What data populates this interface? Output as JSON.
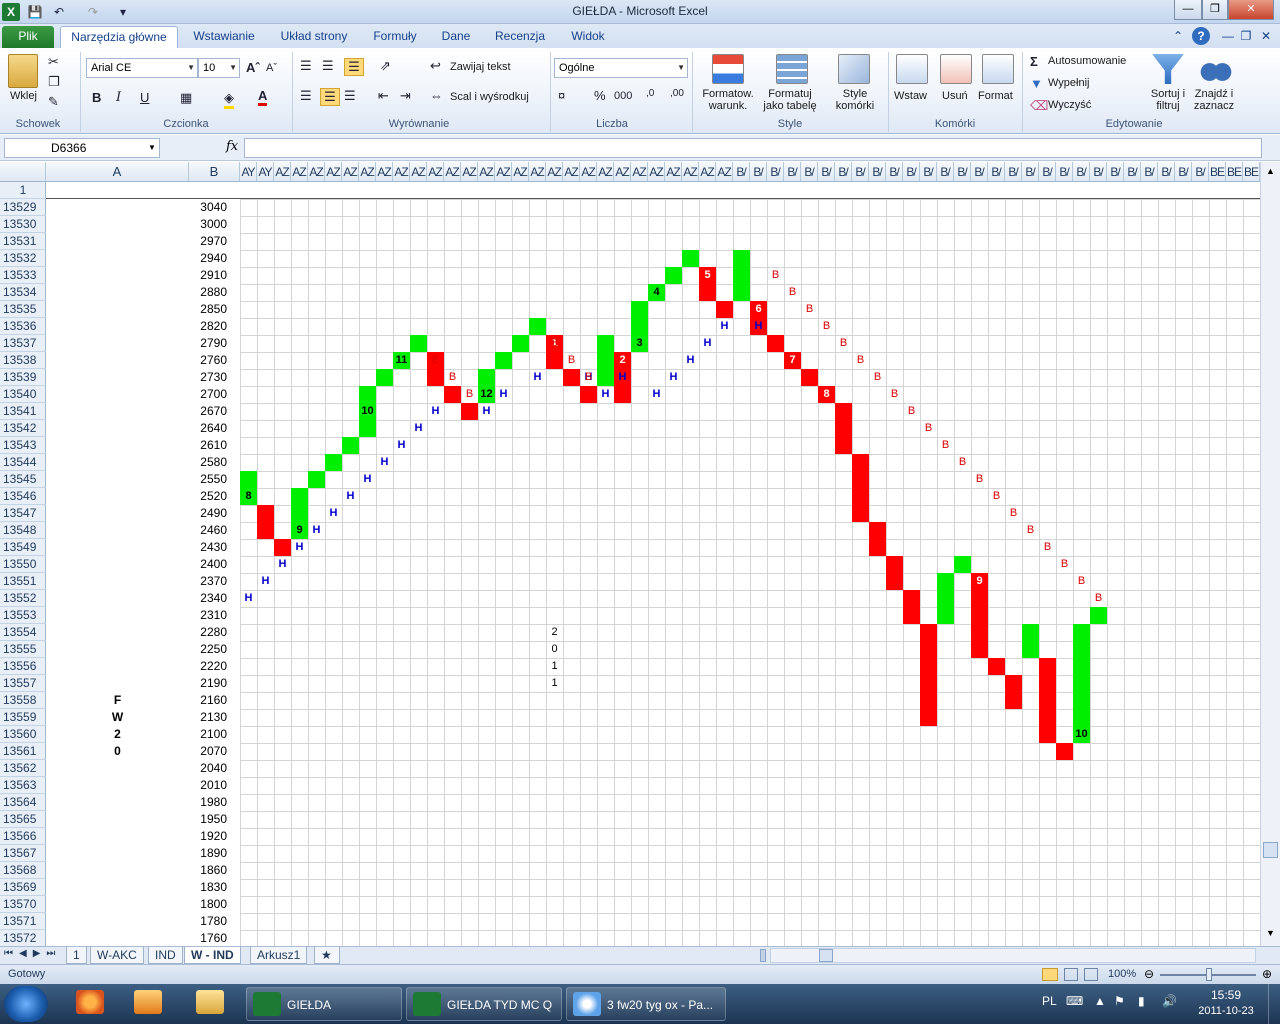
{
  "window": {
    "title": "GIEŁDA  -  Microsoft Excel"
  },
  "ribbon": {
    "tabs": [
      "Plik",
      "Narzędzia główne",
      "Wstawianie",
      "Układ strony",
      "Formuły",
      "Dane",
      "Recenzja",
      "Widok"
    ],
    "groups": {
      "schowek": {
        "label": "Schowek",
        "paste": "Wklej"
      },
      "czcionka": {
        "label": "Czcionka",
        "font": "Arial CE",
        "size": "10",
        "bold": "B",
        "italic": "I",
        "underline": "U"
      },
      "wyrownanie": {
        "label": "Wyrównanie",
        "wrap": "Zawijaj tekst",
        "merge": "Scal i wyśrodkuj"
      },
      "liczba": {
        "label": "Liczba",
        "format": "Ogólne",
        "percent": "%",
        "thousands": "000"
      },
      "style": {
        "label": "Style",
        "cond_line1": "Formatow.",
        "cond_line2": "warunk.",
        "table_line1": "Formatuj",
        "table_line2": "jako tabelę",
        "cell_line1": "Style",
        "cell_line2": "komórki"
      },
      "komorki": {
        "label": "Komórki",
        "insert": "Wstaw",
        "delete": "Usuń",
        "format": "Format"
      },
      "edytowanie": {
        "label": "Edytowanie",
        "autosum": "Autosumowanie",
        "fill": "Wypełnij",
        "clear": "Wyczyść",
        "sort_line1": "Sortuj i",
        "sort_line2": "filtruj",
        "find_line1": "Znajdź i",
        "find_line2": "zaznacz"
      }
    }
  },
  "formula_bar": {
    "name_box": "D6366",
    "fx": "fx",
    "value": ""
  },
  "columns": {
    "A": "A",
    "B": "B",
    "other": [
      "AY",
      "AY",
      "AZ",
      "AZ",
      "AZ",
      "AZ",
      "AZ",
      "AZ",
      "AZ",
      "AZ",
      "AZ",
      "AZ",
      "AZ",
      "AZ",
      "AZ",
      "AZ",
      "AZ",
      "AZ",
      "AZ",
      "AZ",
      "AZ",
      "AZ",
      "AZ",
      "AZ",
      "AZ",
      "AZ",
      "AZ",
      "AZ",
      "AZ",
      "B/",
      "B/",
      "B/",
      "B/",
      "B/",
      "B/",
      "B/",
      "B/",
      "B/",
      "B/",
      "B/",
      "B/",
      "B/",
      "B/",
      "B/",
      "B/",
      "B/",
      "B/",
      "B/",
      "B/",
      "B/",
      "B/",
      "B/",
      "B/",
      "B/",
      "B/",
      "B/",
      "B/",
      "BE",
      "BE",
      "BE",
      "BE",
      "BE",
      "BE",
      "BE",
      "BE",
      "BE",
      "BE"
    ]
  },
  "row_header_first": "1",
  "rows": [
    {
      "n": "13529",
      "a": "",
      "b": "3040"
    },
    {
      "n": "13530",
      "a": "",
      "b": "3000"
    },
    {
      "n": "13531",
      "a": "",
      "b": "2970"
    },
    {
      "n": "13532",
      "a": "",
      "b": "2940"
    },
    {
      "n": "13533",
      "a": "",
      "b": "2910"
    },
    {
      "n": "13534",
      "a": "",
      "b": "2880"
    },
    {
      "n": "13535",
      "a": "",
      "b": "2850"
    },
    {
      "n": "13536",
      "a": "",
      "b": "2820"
    },
    {
      "n": "13537",
      "a": "",
      "b": "2790"
    },
    {
      "n": "13538",
      "a": "",
      "b": "2760"
    },
    {
      "n": "13539",
      "a": "",
      "b": "2730"
    },
    {
      "n": "13540",
      "a": "",
      "b": "2700"
    },
    {
      "n": "13541",
      "a": "",
      "b": "2670"
    },
    {
      "n": "13542",
      "a": "",
      "b": "2640"
    },
    {
      "n": "13543",
      "a": "",
      "b": "2610"
    },
    {
      "n": "13544",
      "a": "",
      "b": "2580"
    },
    {
      "n": "13545",
      "a": "",
      "b": "2550"
    },
    {
      "n": "13546",
      "a": "",
      "b": "2520"
    },
    {
      "n": "13547",
      "a": "",
      "b": "2490"
    },
    {
      "n": "13548",
      "a": "",
      "b": "2460"
    },
    {
      "n": "13549",
      "a": "",
      "b": "2430"
    },
    {
      "n": "13550",
      "a": "",
      "b": "2400"
    },
    {
      "n": "13551",
      "a": "",
      "b": "2370"
    },
    {
      "n": "13552",
      "a": "",
      "b": "2340"
    },
    {
      "n": "13553",
      "a": "",
      "b": "2310"
    },
    {
      "n": "13554",
      "a": "",
      "b": "2280"
    },
    {
      "n": "13555",
      "a": "",
      "b": "2250"
    },
    {
      "n": "13556",
      "a": "",
      "b": "2220"
    },
    {
      "n": "13557",
      "a": "",
      "b": "2190"
    },
    {
      "n": "13558",
      "a": "F",
      "b": "2160"
    },
    {
      "n": "13559",
      "a": "W",
      "b": "2130"
    },
    {
      "n": "13560",
      "a": "2",
      "b": "2100"
    },
    {
      "n": "13561",
      "a": "0",
      "b": "2070"
    },
    {
      "n": "13562",
      "a": "",
      "b": "2040"
    },
    {
      "n": "13563",
      "a": "",
      "b": "2010"
    },
    {
      "n": "13564",
      "a": "",
      "b": "1980"
    },
    {
      "n": "13565",
      "a": "",
      "b": "1950"
    },
    {
      "n": "13566",
      "a": "",
      "b": "1920"
    },
    {
      "n": "13567",
      "a": "",
      "b": "1890"
    },
    {
      "n": "13568",
      "a": "",
      "b": "1860"
    },
    {
      "n": "13569",
      "a": "",
      "b": "1830"
    },
    {
      "n": "13570",
      "a": "",
      "b": "1800"
    },
    {
      "n": "13571",
      "a": "",
      "b": "1780"
    },
    {
      "n": "13572",
      "a": "",
      "b": "1760"
    }
  ],
  "pf_legend": {
    "x_color": "#00ee00",
    "o_color": "#ff0000",
    "h_color": "#0000cc",
    "b_color": "#dd0000"
  },
  "pf_cells": [
    [
      "x",
      0,
      16,
      ""
    ],
    [
      "x",
      0,
      17,
      "8"
    ],
    [
      "o",
      1,
      18,
      ""
    ],
    [
      "o",
      1,
      19,
      ""
    ],
    [
      "o",
      2,
      20,
      ""
    ],
    [
      "x",
      3,
      17,
      ""
    ],
    [
      "x",
      3,
      18,
      ""
    ],
    [
      "x",
      3,
      19,
      "9"
    ],
    [
      "x",
      4,
      16,
      ""
    ],
    [
      "x",
      5,
      15,
      ""
    ],
    [
      "x",
      6,
      14,
      ""
    ],
    [
      "x",
      7,
      13,
      ""
    ],
    [
      "x",
      7,
      12,
      "10"
    ],
    [
      "x",
      7,
      11,
      ""
    ],
    [
      "x",
      8,
      10,
      ""
    ],
    [
      "x",
      9,
      9,
      "11"
    ],
    [
      "x",
      10,
      8,
      ""
    ],
    [
      "o",
      11,
      9,
      ""
    ],
    [
      "o",
      11,
      10,
      ""
    ],
    [
      "o",
      12,
      11,
      ""
    ],
    [
      "o",
      13,
      12,
      ""
    ],
    [
      "x",
      14,
      11,
      "12"
    ],
    [
      "x",
      14,
      10,
      ""
    ],
    [
      "x",
      15,
      9,
      ""
    ],
    [
      "x",
      16,
      8,
      ""
    ],
    [
      "x",
      17,
      7,
      ""
    ],
    [
      "o",
      18,
      8,
      "1"
    ],
    [
      "o",
      18,
      9,
      ""
    ],
    [
      "o",
      19,
      10,
      ""
    ],
    [
      "o",
      20,
      11,
      ""
    ],
    [
      "x",
      21,
      10,
      ""
    ],
    [
      "x",
      21,
      9,
      ""
    ],
    [
      "x",
      21,
      8,
      ""
    ],
    [
      "o",
      22,
      9,
      "2"
    ],
    [
      "o",
      22,
      10,
      ""
    ],
    [
      "o",
      22,
      11,
      ""
    ],
    [
      "x",
      23,
      8,
      "3"
    ],
    [
      "x",
      23,
      7,
      ""
    ],
    [
      "x",
      23,
      6,
      ""
    ],
    [
      "x",
      24,
      5,
      "4"
    ],
    [
      "x",
      25,
      4,
      ""
    ],
    [
      "x",
      26,
      3,
      ""
    ],
    [
      "o",
      27,
      4,
      "5"
    ],
    [
      "o",
      27,
      5,
      ""
    ],
    [
      "o",
      28,
      6,
      ""
    ],
    [
      "x",
      29,
      5,
      ""
    ],
    [
      "x",
      29,
      4,
      ""
    ],
    [
      "x",
      29,
      3,
      ""
    ],
    [
      "o",
      30,
      6,
      "6"
    ],
    [
      "o",
      30,
      7,
      ""
    ],
    [
      "o",
      31,
      8,
      ""
    ],
    [
      "o",
      32,
      9,
      "7"
    ],
    [
      "o",
      33,
      10,
      ""
    ],
    [
      "o",
      34,
      11,
      "8"
    ],
    [
      "o",
      35,
      12,
      ""
    ],
    [
      "o",
      35,
      13,
      ""
    ],
    [
      "o",
      35,
      14,
      ""
    ],
    [
      "o",
      36,
      15,
      ""
    ],
    [
      "o",
      36,
      16,
      ""
    ],
    [
      "o",
      36,
      17,
      ""
    ],
    [
      "o",
      36,
      18,
      ""
    ],
    [
      "o",
      37,
      19,
      ""
    ],
    [
      "o",
      37,
      20,
      ""
    ],
    [
      "o",
      38,
      21,
      ""
    ],
    [
      "o",
      38,
      22,
      ""
    ],
    [
      "o",
      39,
      23,
      ""
    ],
    [
      "o",
      39,
      24,
      ""
    ],
    [
      "o",
      40,
      25,
      ""
    ],
    [
      "o",
      40,
      26,
      ""
    ],
    [
      "o",
      40,
      27,
      ""
    ],
    [
      "o",
      40,
      28,
      ""
    ],
    [
      "o",
      40,
      29,
      ""
    ],
    [
      "o",
      40,
      30,
      ""
    ],
    [
      "x",
      41,
      22,
      ""
    ],
    [
      "x",
      41,
      23,
      ""
    ],
    [
      "x",
      41,
      24,
      ""
    ],
    [
      "x",
      42,
      21,
      ""
    ],
    [
      "o",
      43,
      22,
      "9"
    ],
    [
      "o",
      43,
      23,
      ""
    ],
    [
      "o",
      43,
      24,
      ""
    ],
    [
      "o",
      43,
      25,
      ""
    ],
    [
      "o",
      43,
      26,
      ""
    ],
    [
      "o",
      44,
      27,
      ""
    ],
    [
      "o",
      45,
      28,
      ""
    ],
    [
      "o",
      45,
      29,
      ""
    ],
    [
      "x",
      46,
      25,
      ""
    ],
    [
      "x",
      46,
      26,
      ""
    ],
    [
      "o",
      47,
      27,
      ""
    ],
    [
      "o",
      47,
      28,
      ""
    ],
    [
      "o",
      47,
      29,
      ""
    ],
    [
      "o",
      47,
      30,
      ""
    ],
    [
      "o",
      47,
      31,
      ""
    ],
    [
      "o",
      48,
      32,
      ""
    ],
    [
      "x",
      49,
      31,
      "10"
    ],
    [
      "x",
      49,
      30,
      ""
    ],
    [
      "x",
      49,
      29,
      ""
    ],
    [
      "x",
      49,
      28,
      ""
    ],
    [
      "x",
      49,
      27,
      ""
    ],
    [
      "x",
      49,
      26,
      ""
    ],
    [
      "x",
      49,
      25,
      ""
    ],
    [
      "x",
      50,
      24,
      ""
    ],
    [
      "h",
      0,
      23,
      "H"
    ],
    [
      "h",
      1,
      22,
      "H"
    ],
    [
      "h",
      2,
      21,
      "H"
    ],
    [
      "h",
      3,
      20,
      "H"
    ],
    [
      "h",
      4,
      19,
      "H"
    ],
    [
      "h",
      5,
      18,
      "H"
    ],
    [
      "h",
      6,
      17,
      "H"
    ],
    [
      "h",
      7,
      16,
      "H"
    ],
    [
      "h",
      8,
      15,
      "H"
    ],
    [
      "h",
      9,
      14,
      "H"
    ],
    [
      "h",
      10,
      13,
      "H"
    ],
    [
      "h",
      11,
      12,
      "H"
    ],
    [
      "h",
      14,
      12,
      "H"
    ],
    [
      "h",
      15,
      11,
      "H"
    ],
    [
      "h",
      17,
      10,
      "H"
    ],
    [
      "h",
      20,
      10,
      "H"
    ],
    [
      "h",
      21,
      11,
      "H"
    ],
    [
      "h",
      22,
      10,
      "H"
    ],
    [
      "h",
      24,
      11,
      "H"
    ],
    [
      "h",
      25,
      10,
      "H"
    ],
    [
      "h",
      26,
      9,
      "H"
    ],
    [
      "h",
      27,
      8,
      "H"
    ],
    [
      "h",
      28,
      7,
      "H"
    ],
    [
      "h",
      30,
      7,
      "H"
    ],
    [
      "b",
      11,
      9,
      "B"
    ],
    [
      "b",
      12,
      10,
      "B"
    ],
    [
      "b",
      13,
      11,
      "B"
    ],
    [
      "b",
      18,
      8,
      "B"
    ],
    [
      "b",
      19,
      9,
      "B"
    ],
    [
      "b",
      20,
      10,
      "B"
    ],
    [
      "b",
      31,
      4,
      "B"
    ],
    [
      "b",
      32,
      5,
      "B"
    ],
    [
      "b",
      33,
      6,
      "B"
    ],
    [
      "b",
      34,
      7,
      "B"
    ],
    [
      "b",
      35,
      8,
      "B"
    ],
    [
      "b",
      36,
      9,
      "B"
    ],
    [
      "b",
      37,
      10,
      "B"
    ],
    [
      "b",
      38,
      11,
      "B"
    ],
    [
      "b",
      39,
      12,
      "B"
    ],
    [
      "b",
      40,
      13,
      "B"
    ],
    [
      "b",
      41,
      14,
      "B"
    ],
    [
      "b",
      42,
      15,
      "B"
    ],
    [
      "b",
      43,
      16,
      "B"
    ],
    [
      "b",
      44,
      17,
      "B"
    ],
    [
      "b",
      45,
      18,
      "B"
    ],
    [
      "b",
      46,
      19,
      "B"
    ],
    [
      "b",
      47,
      20,
      "B"
    ],
    [
      "b",
      48,
      21,
      "B"
    ],
    [
      "b",
      49,
      22,
      "B"
    ],
    [
      "b",
      50,
      23,
      "B"
    ]
  ],
  "side_numbers": [
    "2",
    "0",
    "1",
    "1"
  ],
  "sheet_tabs": [
    "1",
    "W-AKC",
    "IND",
    "W - IND",
    "Arkusz1"
  ],
  "active_sheet": "W - IND",
  "status": {
    "ready": "Gotowy",
    "zoom": "100%"
  },
  "taskbar": {
    "items": [
      "GIEŁDA",
      "GIEŁDA TYD MC Q",
      "3 fw20 tyg ox - Pa..."
    ],
    "lang": "PL",
    "time": "15:59",
    "date": "2011-10-23"
  }
}
